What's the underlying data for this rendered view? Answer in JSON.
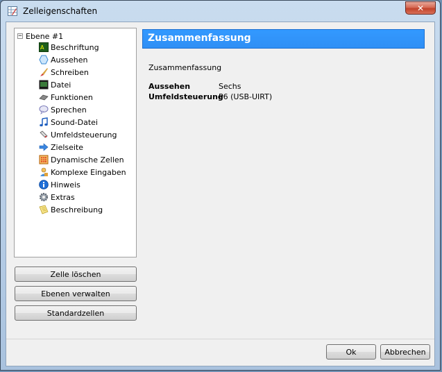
{
  "window": {
    "title": "Zelleigenschaften",
    "close_glyph": "✕"
  },
  "tree": {
    "root_label": "Ebene #1",
    "expander_glyph": "−",
    "items": [
      {
        "label": "Beschriftung",
        "icon": "label-icon"
      },
      {
        "label": "Aussehen",
        "icon": "hexagon-icon"
      },
      {
        "label": "Schreiben",
        "icon": "brush-icon"
      },
      {
        "label": "Datei",
        "icon": "screen-icon"
      },
      {
        "label": "Funktionen",
        "icon": "keyboard-icon"
      },
      {
        "label": "Sprechen",
        "icon": "speech-bubble-icon"
      },
      {
        "label": "Sound-Datei",
        "icon": "music-note-icon"
      },
      {
        "label": "Umfeldsteuerung",
        "icon": "remote-icon"
      },
      {
        "label": "Zielseite",
        "icon": "arrow-right-icon"
      },
      {
        "label": "Dynamische Zellen",
        "icon": "grid-icon"
      },
      {
        "label": "Komplexe Eingaben",
        "icon": "user-icon"
      },
      {
        "label": "Hinweis",
        "icon": "info-icon"
      },
      {
        "label": "Extras",
        "icon": "gear-icon"
      },
      {
        "label": "Beschreibung",
        "icon": "note-icon"
      }
    ]
  },
  "buttons": {
    "delete_cell": "Zelle löschen",
    "manage_layers": "Ebenen verwalten",
    "standard_cells": "Standardzellen",
    "ok": "Ok",
    "cancel": "Abbrechen"
  },
  "summary": {
    "header": "Zusammenfassung",
    "subtitle": "Zusammenfassung",
    "rows": [
      {
        "key": "Aussehen",
        "value": "Sechs"
      },
      {
        "key": "Umfeldsteuerung",
        "value": "P6 (USB-UIRT)"
      }
    ]
  },
  "colors": {
    "header_blue": "#3399ff",
    "close_red": "#c2432b"
  }
}
